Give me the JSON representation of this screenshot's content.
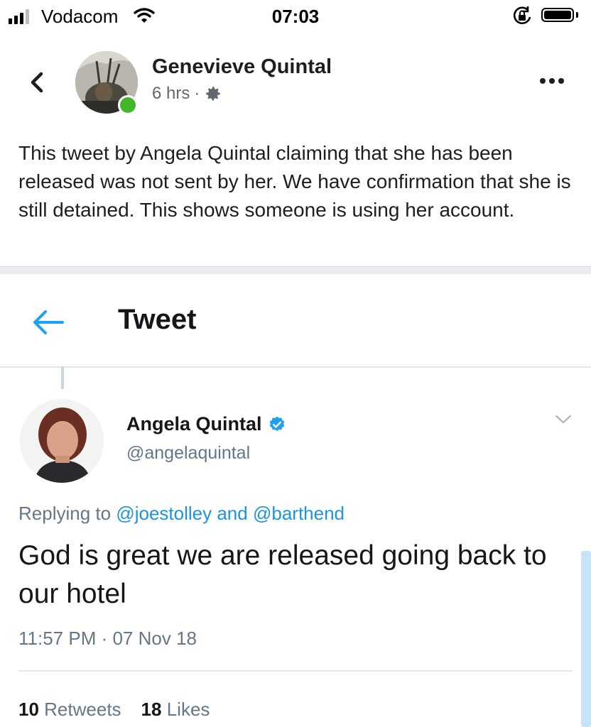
{
  "status_bar": {
    "carrier": "Vodacom",
    "time": "07:03",
    "signal_bars": 4,
    "signal_active": 3,
    "icons": [
      "cellular-signal-icon",
      "wifi-icon",
      "rotation-lock-icon",
      "battery-icon"
    ]
  },
  "post": {
    "author": "Genevieve Quintal",
    "time_ago": "6 hrs",
    "separator": "·",
    "privacy_icon": "gear-icon",
    "online": true,
    "text": "This tweet by Angela Quintal claiming that she has been released was not sent by her. We have confirmation that she is still detained. This shows someone is using her account."
  },
  "tweet": {
    "header_title": "Tweet",
    "author_name": "Angela Quintal",
    "verified": true,
    "handle": "@angelaquintal",
    "reply_prefix": "Replying to",
    "reply_mention_1": "@joestolley",
    "reply_and": "and",
    "reply_mention_2": "@barthend",
    "body": "God is great we are released going back to our hotel",
    "timestamp": "11:57 PM · 07 Nov 18",
    "retweets_count": "10",
    "retweets_label": "Retweets",
    "likes_count": "18",
    "likes_label": "Likes"
  },
  "colors": {
    "online_green": "#42b72a",
    "twitter_blue": "#1da1f2",
    "mention_blue": "#1b95e0",
    "tweet_gray": "#657786"
  }
}
